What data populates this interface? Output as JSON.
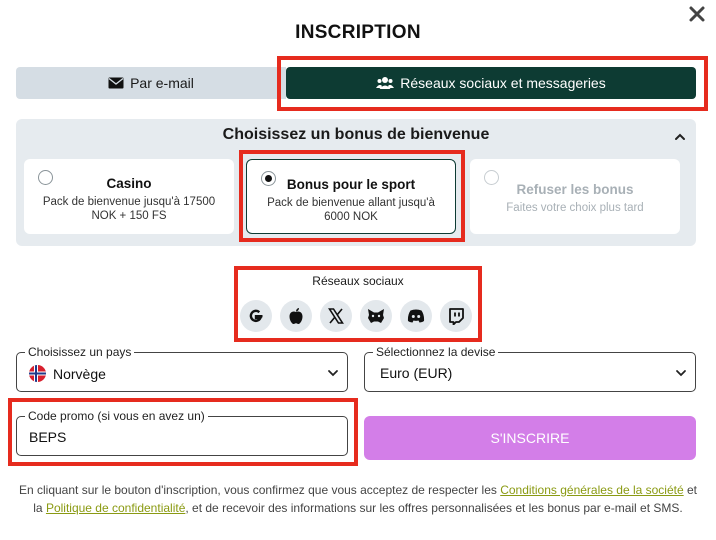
{
  "modal": {
    "title": "INSCRIPTION",
    "close_icon": "close-icon"
  },
  "tabs": {
    "email": {
      "label": "Par e-mail",
      "icon": "envelope-icon"
    },
    "social": {
      "label": "Réseaux sociaux et messageries",
      "icon": "users-icon"
    }
  },
  "bonus": {
    "title": "Choisissez un bonus de bienvenue",
    "options": [
      {
        "name": "Casino",
        "desc": "Pack de bienvenue jusqu'à 17500 NOK + 150 FS",
        "selected": false
      },
      {
        "name": "Bonus pour le sport",
        "desc": "Pack de bienvenue allant jusqu'à 6000 NOK",
        "selected": true
      },
      {
        "name": "Refuser les bonus",
        "desc": "Faites votre choix plus tard",
        "selected": false
      }
    ]
  },
  "social": {
    "label": "Réseaux sociaux",
    "networks": [
      "google-icon",
      "apple-icon",
      "x-icon",
      "metamask-icon",
      "discord-icon",
      "twitch-icon"
    ]
  },
  "form": {
    "country": {
      "label": "Choisissez un pays",
      "value": "Norvège"
    },
    "currency": {
      "label": "Sélectionnez la devise",
      "value": "Euro (EUR)"
    },
    "promo": {
      "label": "Code promo (si vous en avez un)",
      "value": "BEPS"
    },
    "submit_label": "S'INSCRIRE"
  },
  "legal": {
    "part1": "En cliquant sur le bouton d'inscription, vous confirmez que vous acceptez de respecter les ",
    "terms_link": "Conditions générales de la société",
    "part2": " et la ",
    "privacy_link": "Politique de confidentialité",
    "part3": ", et de recevoir des informations sur les offres personnalisées et les bonus par e-mail et SMS."
  },
  "colors": {
    "accent_dark": "#0d3b33",
    "submit": "#d37ee8",
    "highlight": "#e62b1e",
    "link": "#8a9a12"
  }
}
